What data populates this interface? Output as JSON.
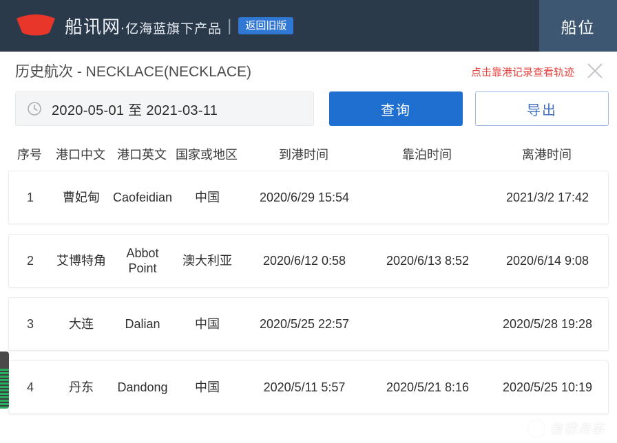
{
  "topbar": {
    "logo_icon": "boat-logo-icon",
    "brand_name": "船讯网",
    "brand_separator": "·",
    "brand_subtitle": "亿海蓝旗下产品",
    "divider": "|",
    "old_version_label": "返回旧版",
    "nav_tab_label": "船位",
    "bg_color": "#2b3a4b",
    "tab_bg_color": "#3d5672",
    "badge_color": "#3178d4"
  },
  "panel": {
    "title": "历史航次 - NECKLACE(NECKLACE)",
    "hint_text": "点击靠港记录查看轨迹",
    "hint_color": "#e8433f",
    "close_icon": "close-icon"
  },
  "query": {
    "clock_icon": "clock-icon",
    "date_range_value": "2020-05-01 至 2021-03-11",
    "search_label": "查询",
    "export_label": "导出",
    "search_color": "#1f6fd0",
    "export_text_color": "#3f6fbf"
  },
  "table": {
    "headers": [
      "序号",
      "港口中文",
      "港口英文",
      "国家或地区",
      "到港时间",
      "靠泊时间",
      "离港时间"
    ],
    "rows": [
      {
        "index": "1",
        "port_cn": "曹妃甸",
        "port_en": "Caofeidian",
        "country": "中国",
        "arrival": "2020/6/29 15:54",
        "berth": "",
        "departure": "2021/3/2 17:42"
      },
      {
        "index": "2",
        "port_cn": "艾博特角",
        "port_en": "Abbot\nPoint",
        "country": "澳大利亚",
        "arrival": "2020/6/12 0:58",
        "berth": "2020/6/13 8:52",
        "departure": "2020/6/14 9:08"
      },
      {
        "index": "3",
        "port_cn": "大连",
        "port_en": "Dalian",
        "country": "中国",
        "arrival": "2020/5/25 22:57",
        "berth": "",
        "departure": "2020/5/28 19:28"
      },
      {
        "index": "4",
        "port_cn": "丹东",
        "port_en": "Dandong",
        "country": "中国",
        "arrival": "2020/5/11 5:57",
        "berth": "2020/5/21 8:16",
        "departure": "2020/5/25 10:19"
      }
    ]
  },
  "watermark": {
    "icon": "smiley-circle-icon",
    "text": "信德海事"
  },
  "edge_widget": {
    "icon": "signal-bars-widget"
  }
}
